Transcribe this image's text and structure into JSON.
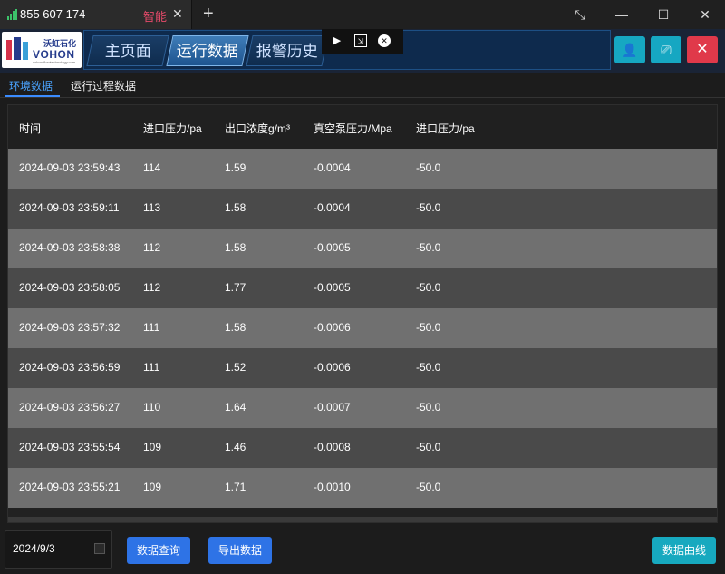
{
  "browser": {
    "tab_title": "855 607 174",
    "tab_tag": "智能",
    "close_glyph": "✕",
    "new_tab_glyph": "+",
    "window_controls": [
      "⤡",
      "—",
      "☐",
      "✕"
    ]
  },
  "app": {
    "logo": {
      "cn": "沃虹石化",
      "en": "VOHON",
      "small": "vohon-flowtechnology.com"
    },
    "nav_tabs": [
      {
        "label": "主页面",
        "active": false
      },
      {
        "label": "运行数据",
        "active": true
      },
      {
        "label": "报警历史",
        "active": false
      }
    ],
    "header_buttons": {
      "user": "👤",
      "screen": "⎚",
      "close": "✕"
    },
    "accent_colors": {
      "teal": "#16a7c2",
      "red": "#e0394a",
      "blue": "#2e73e6",
      "active_tab": "#4aa3ff"
    }
  },
  "subtabs": [
    {
      "label": "环境数据",
      "active": true
    },
    {
      "label": "运行过程数据",
      "active": false
    }
  ],
  "table": {
    "headers": [
      "时间",
      "进口压力/pa",
      "出口浓度g/m³",
      "真空泵压力/Mpa",
      "进口压力/pa"
    ],
    "rows": [
      [
        "2024-09-03 23:59:43",
        "114",
        "1.59",
        "-0.0004",
        "-50.0"
      ],
      [
        "2024-09-03 23:59:11",
        "113",
        "1.58",
        "-0.0004",
        "-50.0"
      ],
      [
        "2024-09-03 23:58:38",
        "112",
        "1.58",
        "-0.0005",
        "-50.0"
      ],
      [
        "2024-09-03 23:58:05",
        "112",
        "1.77",
        "-0.0005",
        "-50.0"
      ],
      [
        "2024-09-03 23:57:32",
        "111",
        "1.58",
        "-0.0006",
        "-50.0"
      ],
      [
        "2024-09-03 23:56:59",
        "111",
        "1.52",
        "-0.0006",
        "-50.0"
      ],
      [
        "2024-09-03 23:56:27",
        "110",
        "1.64",
        "-0.0007",
        "-50.0"
      ],
      [
        "2024-09-03 23:55:54",
        "109",
        "1.46",
        "-0.0008",
        "-50.0"
      ],
      [
        "2024-09-03 23:55:21",
        "109",
        "1.71",
        "-0.0010",
        "-50.0"
      ]
    ]
  },
  "footer": {
    "date_value": "2024/9/3",
    "query_button": "数据查询",
    "export_button": "导出数据",
    "curve_button": "数据曲线"
  }
}
